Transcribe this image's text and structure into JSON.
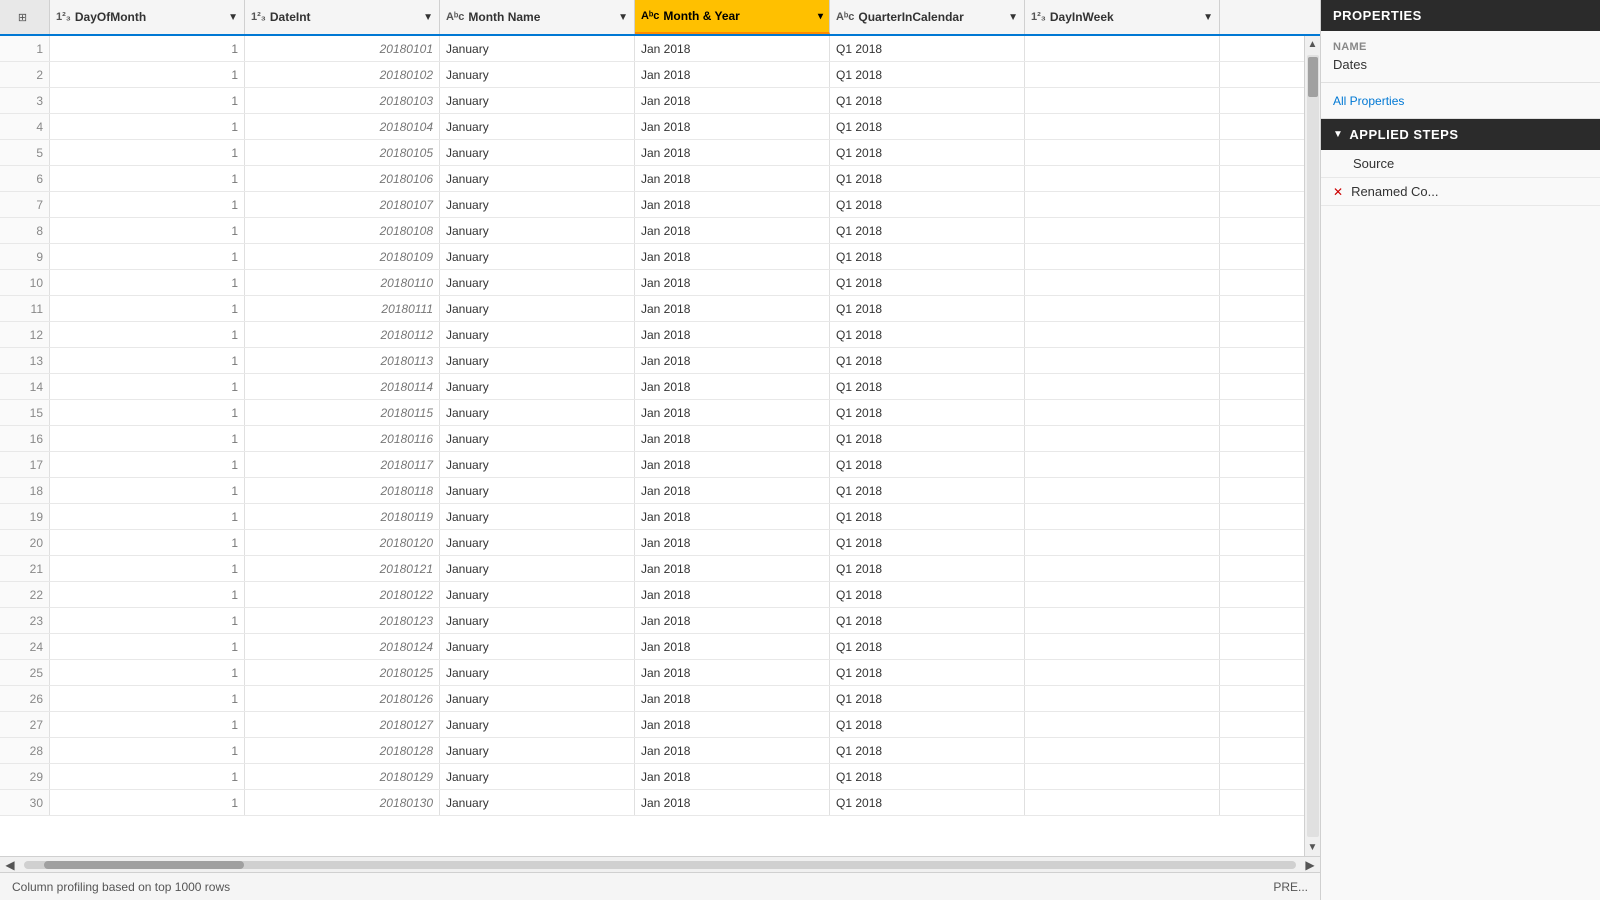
{
  "columns": [
    {
      "id": "rownum",
      "label": "",
      "icon": "",
      "type": "rownum",
      "active": false
    },
    {
      "id": "dayofmonth",
      "label": "DayOfMonth",
      "icon": "1²₃",
      "type": "int",
      "active": false
    },
    {
      "id": "dateint",
      "label": "DateInt",
      "icon": "1²₃",
      "type": "int",
      "active": false
    },
    {
      "id": "monthname",
      "label": "Month Name",
      "icon": "Aᵇc",
      "type": "text",
      "active": false
    },
    {
      "id": "monthyear",
      "label": "Month & Year",
      "icon": "Aᵇc",
      "type": "text",
      "active": true
    },
    {
      "id": "quarterincalendar",
      "label": "QuarterInCalendar",
      "icon": "Aᵇc",
      "type": "text",
      "active": false
    },
    {
      "id": "dayinweek",
      "label": "DayInWeek",
      "icon": "1²₃",
      "type": "int",
      "active": false
    }
  ],
  "rows": [
    {
      "num": 1,
      "dayofmonth": 1,
      "dateint": "20180101",
      "monthname": "January",
      "monthyear": "Jan 2018",
      "quarter": "Q1 2018",
      "dayinweek": ""
    },
    {
      "num": 2,
      "dayofmonth": 1,
      "dateint": "20180102",
      "monthname": "January",
      "monthyear": "Jan 2018",
      "quarter": "Q1 2018",
      "dayinweek": ""
    },
    {
      "num": 3,
      "dayofmonth": 1,
      "dateint": "20180103",
      "monthname": "January",
      "monthyear": "Jan 2018",
      "quarter": "Q1 2018",
      "dayinweek": ""
    },
    {
      "num": 4,
      "dayofmonth": 1,
      "dateint": "20180104",
      "monthname": "January",
      "monthyear": "Jan 2018",
      "quarter": "Q1 2018",
      "dayinweek": ""
    },
    {
      "num": 5,
      "dayofmonth": 1,
      "dateint": "20180105",
      "monthname": "January",
      "monthyear": "Jan 2018",
      "quarter": "Q1 2018",
      "dayinweek": ""
    },
    {
      "num": 6,
      "dayofmonth": 1,
      "dateint": "20180106",
      "monthname": "January",
      "monthyear": "Jan 2018",
      "quarter": "Q1 2018",
      "dayinweek": ""
    },
    {
      "num": 7,
      "dayofmonth": 1,
      "dateint": "20180107",
      "monthname": "January",
      "monthyear": "Jan 2018",
      "quarter": "Q1 2018",
      "dayinweek": ""
    },
    {
      "num": 8,
      "dayofmonth": 1,
      "dateint": "20180108",
      "monthname": "January",
      "monthyear": "Jan 2018",
      "quarter": "Q1 2018",
      "dayinweek": ""
    },
    {
      "num": 9,
      "dayofmonth": 1,
      "dateint": "20180109",
      "monthname": "January",
      "monthyear": "Jan 2018",
      "quarter": "Q1 2018",
      "dayinweek": ""
    },
    {
      "num": 10,
      "dayofmonth": 1,
      "dateint": "20180110",
      "monthname": "January",
      "monthyear": "Jan 2018",
      "quarter": "Q1 2018",
      "dayinweek": ""
    },
    {
      "num": 11,
      "dayofmonth": 1,
      "dateint": "20180111",
      "monthname": "January",
      "monthyear": "Jan 2018",
      "quarter": "Q1 2018",
      "dayinweek": ""
    },
    {
      "num": 12,
      "dayofmonth": 1,
      "dateint": "20180112",
      "monthname": "January",
      "monthyear": "Jan 2018",
      "quarter": "Q1 2018",
      "dayinweek": ""
    },
    {
      "num": 13,
      "dayofmonth": 1,
      "dateint": "20180113",
      "monthname": "January",
      "monthyear": "Jan 2018",
      "quarter": "Q1 2018",
      "dayinweek": ""
    },
    {
      "num": 14,
      "dayofmonth": 1,
      "dateint": "20180114",
      "monthname": "January",
      "monthyear": "Jan 2018",
      "quarter": "Q1 2018",
      "dayinweek": ""
    },
    {
      "num": 15,
      "dayofmonth": 1,
      "dateint": "20180115",
      "monthname": "January",
      "monthyear": "Jan 2018",
      "quarter": "Q1 2018",
      "dayinweek": ""
    },
    {
      "num": 16,
      "dayofmonth": 1,
      "dateint": "20180116",
      "monthname": "January",
      "monthyear": "Jan 2018",
      "quarter": "Q1 2018",
      "dayinweek": ""
    },
    {
      "num": 17,
      "dayofmonth": 1,
      "dateint": "20180117",
      "monthname": "January",
      "monthyear": "Jan 2018",
      "quarter": "Q1 2018",
      "dayinweek": ""
    },
    {
      "num": 18,
      "dayofmonth": 1,
      "dateint": "20180118",
      "monthname": "January",
      "monthyear": "Jan 2018",
      "quarter": "Q1 2018",
      "dayinweek": ""
    },
    {
      "num": 19,
      "dayofmonth": 1,
      "dateint": "20180119",
      "monthname": "January",
      "monthyear": "Jan 2018",
      "quarter": "Q1 2018",
      "dayinweek": ""
    },
    {
      "num": 20,
      "dayofmonth": 1,
      "dateint": "20180120",
      "monthname": "January",
      "monthyear": "Jan 2018",
      "quarter": "Q1 2018",
      "dayinweek": ""
    },
    {
      "num": 21,
      "dayofmonth": 1,
      "dateint": "20180121",
      "monthname": "January",
      "monthyear": "Jan 2018",
      "quarter": "Q1 2018",
      "dayinweek": ""
    },
    {
      "num": 22,
      "dayofmonth": 1,
      "dateint": "20180122",
      "monthname": "January",
      "monthyear": "Jan 2018",
      "quarter": "Q1 2018",
      "dayinweek": ""
    },
    {
      "num": 23,
      "dayofmonth": 1,
      "dateint": "20180123",
      "monthname": "January",
      "monthyear": "Jan 2018",
      "quarter": "Q1 2018",
      "dayinweek": ""
    },
    {
      "num": 24,
      "dayofmonth": 1,
      "dateint": "20180124",
      "monthname": "January",
      "monthyear": "Jan 2018",
      "quarter": "Q1 2018",
      "dayinweek": ""
    },
    {
      "num": 25,
      "dayofmonth": 1,
      "dateint": "20180125",
      "monthname": "January",
      "monthyear": "Jan 2018",
      "quarter": "Q1 2018",
      "dayinweek": ""
    },
    {
      "num": 26,
      "dayofmonth": 1,
      "dateint": "20180126",
      "monthname": "January",
      "monthyear": "Jan 2018",
      "quarter": "Q1 2018",
      "dayinweek": ""
    },
    {
      "num": 27,
      "dayofmonth": 1,
      "dateint": "20180127",
      "monthname": "January",
      "monthyear": "Jan 2018",
      "quarter": "Q1 2018",
      "dayinweek": ""
    },
    {
      "num": 28,
      "dayofmonth": 1,
      "dateint": "20180128",
      "monthname": "January",
      "monthyear": "Jan 2018",
      "quarter": "Q1 2018",
      "dayinweek": ""
    },
    {
      "num": 29,
      "dayofmonth": 1,
      "dateint": "20180129",
      "monthname": "January",
      "monthyear": "Jan 2018",
      "quarter": "Q1 2018",
      "dayinweek": ""
    },
    {
      "num": 30,
      "dayofmonth": 1,
      "dateint": "20180130",
      "monthname": "January",
      "monthyear": "Jan 2018",
      "quarter": "Q1 2018",
      "dayinweek": ""
    }
  ],
  "properties": {
    "title": "PROPERTIES",
    "name_label": "Name",
    "name_value": "Dates",
    "all_properties_link": "All Properties"
  },
  "applied_steps": {
    "title": "APPLIED STEPS",
    "steps": [
      {
        "label": "Source",
        "deletable": false
      },
      {
        "label": "Renamed Co...",
        "deletable": true
      }
    ]
  },
  "status_bar": {
    "text": "Column profiling based on top 1000 rows",
    "right_label": "PRE..."
  }
}
